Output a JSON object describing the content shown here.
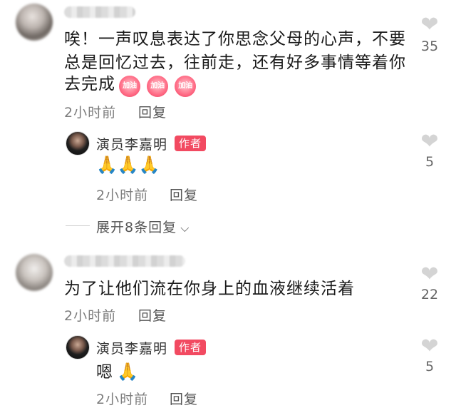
{
  "comments": [
    {
      "text_line1": "唉！一声叹息表达了你思念父母的心声，不要",
      "text_line2": "总是回忆过去，往前走，还有好多事情等着你",
      "text_line3": "去完成",
      "emojis": [
        "加油",
        "加油",
        "加油"
      ],
      "time": "2小时前",
      "reply_label": "回复",
      "likes": "35",
      "reply": {
        "author": "演员李嘉明",
        "badge": "作者",
        "emoji": "🙏🙏🙏",
        "time": "2小时前",
        "reply_label": "回复",
        "likes": "5"
      },
      "expand_label": "展开8条回复"
    },
    {
      "text": "为了让他们流在你身上的血液继续活着",
      "time": "2小时前",
      "reply_label": "回复",
      "likes": "22",
      "reply": {
        "author": "演员李嘉明",
        "badge": "作者",
        "text": "嗯",
        "emoji": "🙏",
        "time": "2小时前",
        "reply_label": "回复",
        "likes": "5"
      }
    }
  ],
  "icons": {
    "like": "heart-icon",
    "expand": "chevron-down-icon"
  },
  "colors": {
    "badge": "#f24a61",
    "like_icon": "#d4d4d4",
    "meta": "#7d7d7d"
  }
}
